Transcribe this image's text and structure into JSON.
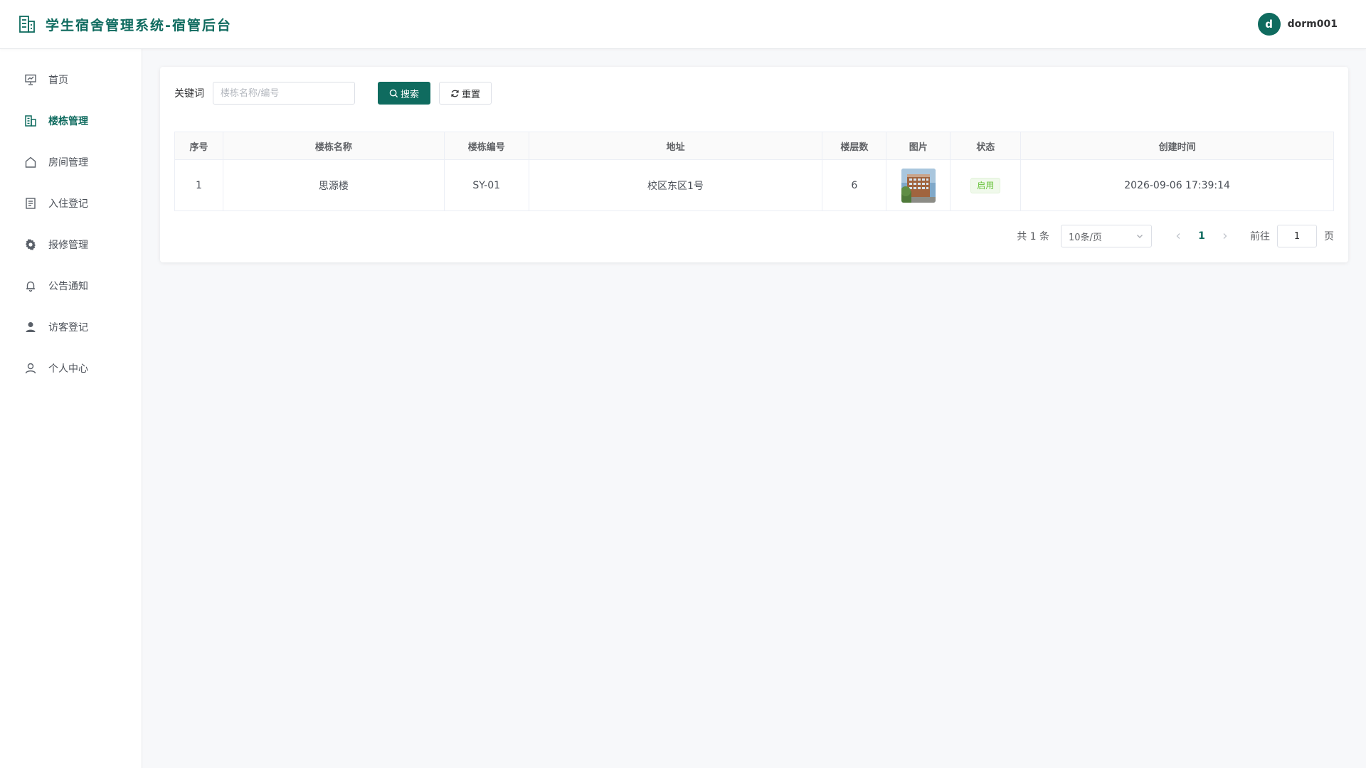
{
  "header": {
    "title": "学生宿舍管理系统-宿管后台",
    "brand_icon": "building-icon",
    "avatar_letter": "d",
    "username": "dorm001",
    "accent": "#0f6b5f"
  },
  "sidebar": {
    "items": [
      {
        "label": "首页",
        "icon": "presentation-icon",
        "active": false
      },
      {
        "label": "楼栋管理",
        "icon": "building-icon",
        "active": true
      },
      {
        "label": "房间管理",
        "icon": "house-icon",
        "active": false
      },
      {
        "label": "入住登记",
        "icon": "document-icon",
        "active": false
      },
      {
        "label": "报修管理",
        "icon": "gear-icon",
        "active": false
      },
      {
        "label": "公告通知",
        "icon": "bell-icon",
        "active": false
      },
      {
        "label": "访客登记",
        "icon": "user-filled-icon",
        "active": false
      },
      {
        "label": "个人中心",
        "icon": "user-outline-icon",
        "active": false
      }
    ]
  },
  "search": {
    "label": "关键词",
    "placeholder": "楼栋名称/编号",
    "value": "",
    "search_label": "搜索",
    "reset_label": "重置"
  },
  "table": {
    "columns": [
      "序号",
      "楼栋名称",
      "楼栋编号",
      "地址",
      "楼层数",
      "图片",
      "状态",
      "创建时间"
    ],
    "rows": [
      {
        "index": "1",
        "name": "思源楼",
        "code": "SY-01",
        "address": "校区东区1号",
        "floors": "6",
        "status": "启用",
        "created": "2026-09-06 17:39:14"
      }
    ]
  },
  "pagination": {
    "total": "共 1 条",
    "page_size": "10条/页",
    "current_page": "1",
    "goto_label": "前往",
    "goto_value": "1",
    "goto_suffix": "页"
  }
}
